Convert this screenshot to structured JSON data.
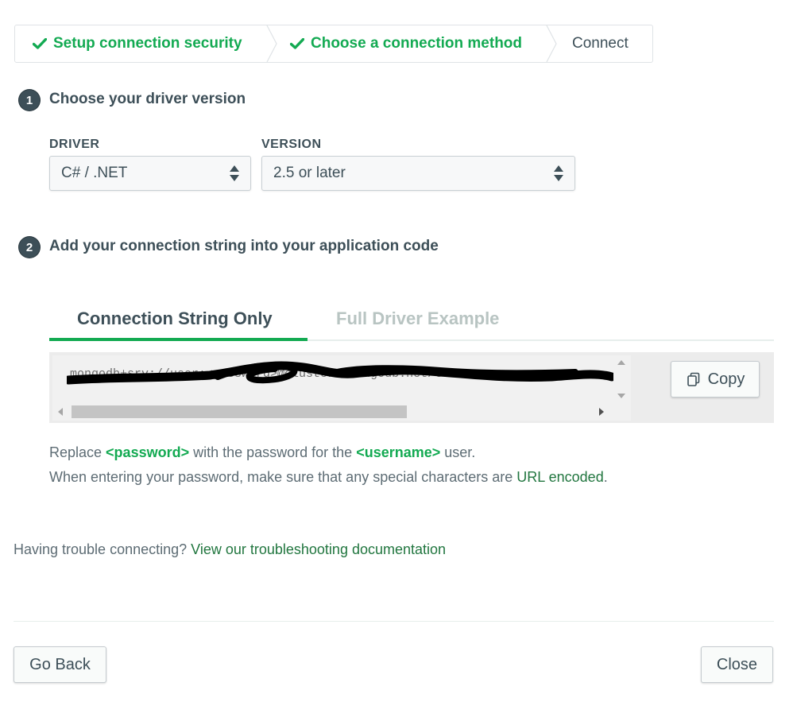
{
  "wizard": {
    "steps": [
      {
        "label": "Setup connection security",
        "done": true
      },
      {
        "label": "Choose a connection method",
        "done": true
      },
      {
        "label": "Connect",
        "done": false
      }
    ]
  },
  "section1": {
    "number": "1",
    "title": "Choose your driver version",
    "driver_label": "DRIVER",
    "driver_value": "C# / .NET",
    "version_label": "VERSION",
    "version_value": "2.5 or later"
  },
  "section2": {
    "number": "2",
    "title": "Add your connection string into your application code"
  },
  "tabs": [
    {
      "label": "Connection String Only",
      "active": true
    },
    {
      "label": "Full Driver Example",
      "active": false
    }
  ],
  "connection_string": "mongodb+srv://user:<password>@cluster0.mongodb.net/test",
  "copy_label": "Copy",
  "help": {
    "line1_pre": "Replace ",
    "line1_password": "<password>",
    "line1_mid": " with the password for the ",
    "line1_username": "<username>",
    "line1_post": " user.",
    "line2_pre": "When entering your password, make sure that any special characters are ",
    "line2_link": "URL encoded",
    "line2_post": "."
  },
  "trouble": {
    "text": "Having trouble connecting? ",
    "link": "View our troubleshooting documentation"
  },
  "footer": {
    "back_label": "Go Back",
    "close_label": "Close"
  },
  "colors": {
    "accent": "#13aa52",
    "link": "#21763f",
    "text": "#3d4f58"
  }
}
